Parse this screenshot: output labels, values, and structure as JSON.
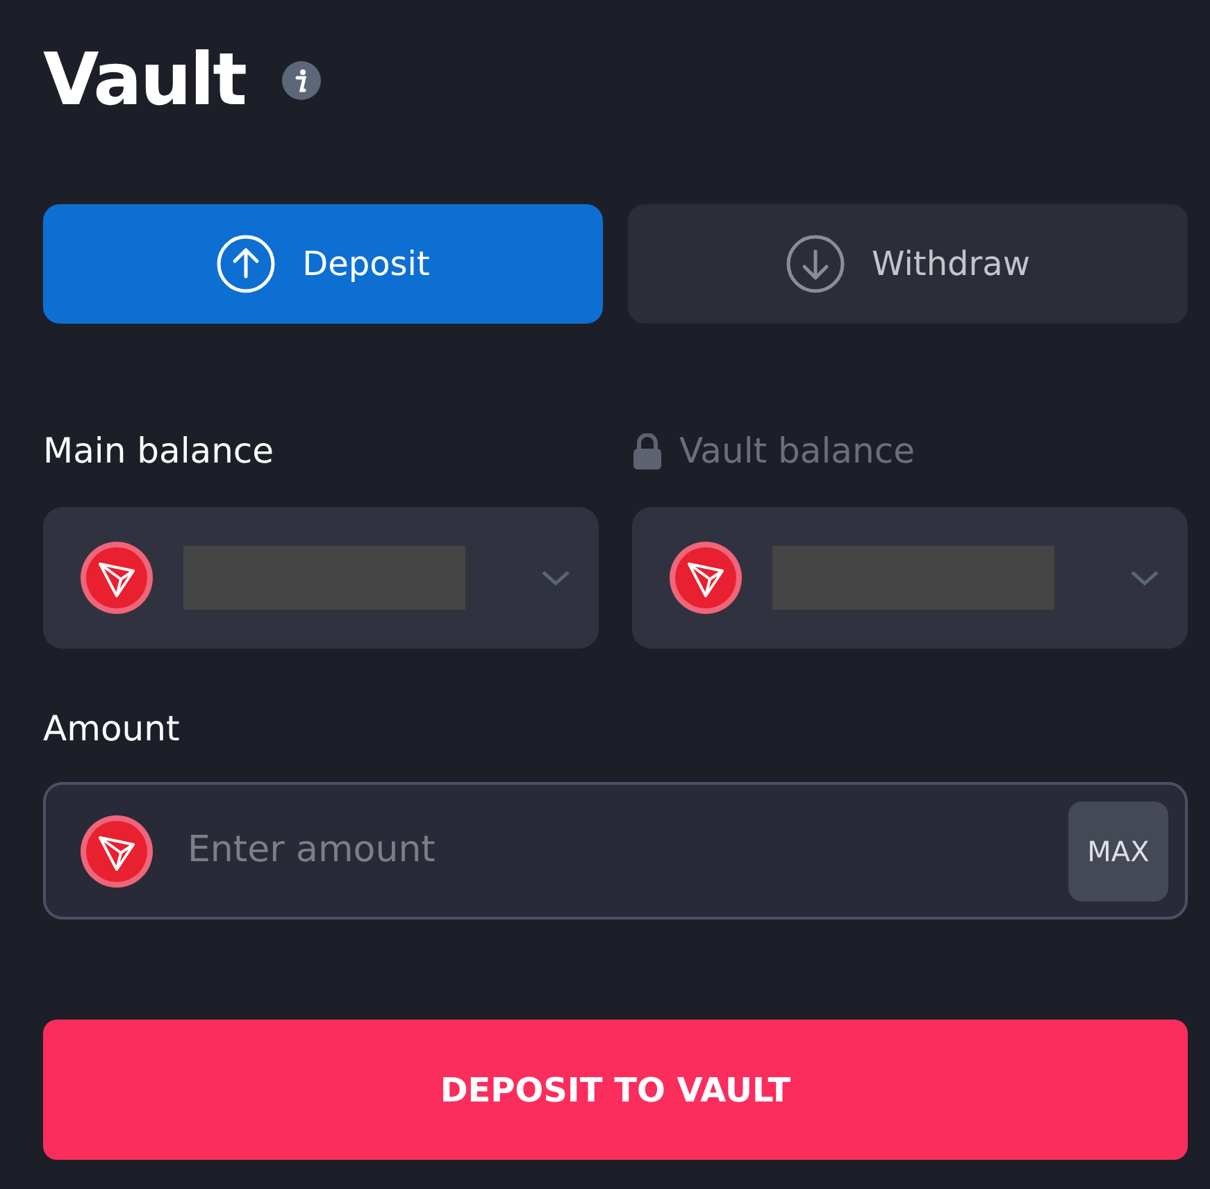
{
  "title": "Vault",
  "tabs": [
    {
      "label": "Deposit",
      "kind": "deposit",
      "selected": true
    },
    {
      "label": "Withdraw",
      "kind": "withdraw",
      "selected": false
    }
  ],
  "balances": [
    {
      "label": "Main balance",
      "locked": false
    },
    {
      "label": "Vault balance",
      "locked": true
    }
  ],
  "amount": {
    "label": "Amount",
    "placeholder": "Enter amount",
    "max_button": "MAX"
  },
  "submit": "DEPOSIT TO VAULT"
}
